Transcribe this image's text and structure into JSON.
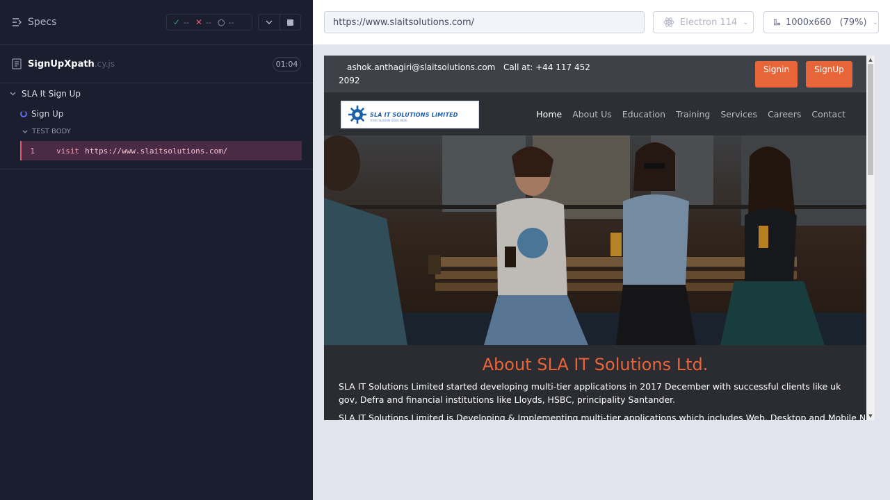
{
  "reporter": {
    "specs_label": "Specs",
    "stats": {
      "passed": "--",
      "failed": "--",
      "pending": "--"
    },
    "spec_file": {
      "name": "SignUpXpath",
      "ext": ".cy.js",
      "duration": "01:04"
    },
    "suite": {
      "title": "SLA It Sign Up"
    },
    "test": {
      "title": "Sign Up",
      "state": "running"
    },
    "test_body_label": "TEST BODY",
    "command": {
      "number": "1",
      "name": "visit",
      "message": "https://www.slaitsolutions.com/"
    }
  },
  "aut": {
    "url": "https://www.slaitsolutions.com/",
    "browser": "Electron 114",
    "viewport": "1000x660",
    "scale": "(79%)"
  },
  "site": {
    "email": "ashok.anthagiri@slaitsolutions.com",
    "phone": "Call at: +44 117 452",
    "phone_tail": "2092",
    "signin": "Signin",
    "signup": "SignUp",
    "logo_text": "SLA IT SOLUTIONS LIMITED",
    "logo_sub": "YOUR SLOGAN GOES HERE",
    "nav": [
      "Home",
      "About Us",
      "Education",
      "Training",
      "Services",
      "Careers",
      "Contact"
    ],
    "about_title": "About SLA IT Solutions Ltd.",
    "about_p1": "SLA IT Solutions Limited started developing multi-tier applications in 2017 December with successful clients like uk gov, Defra and financial institutions like Lloyds, HSBC, principality Santander.",
    "about_p2": "SLA IT Solutions Limited is Developing & Implementing multi-tier applications which includes Web, Desktop and Mobile Native"
  },
  "colors": {
    "accent": "#e8653a",
    "reporter_bg": "#1b1e2e",
    "pass": "#1fa971",
    "fail": "#e45770",
    "running": "#6470f3"
  }
}
